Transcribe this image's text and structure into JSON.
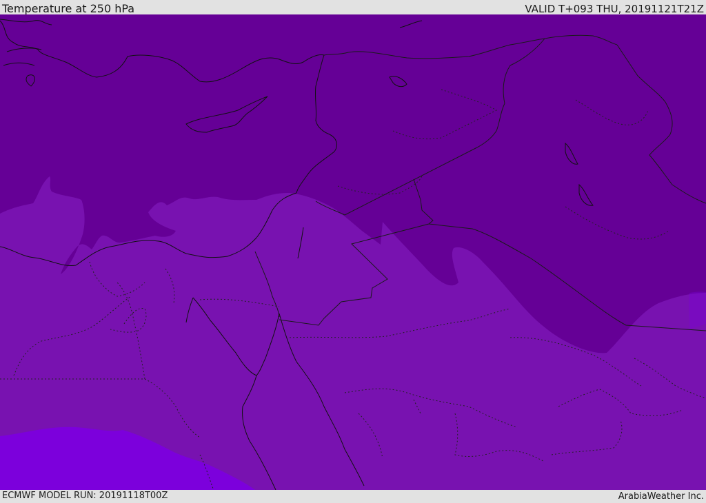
{
  "header": {
    "title": "Temperature at 250 hPa",
    "valid": "VALID T+093 THU, 20191121T21Z"
  },
  "footer": {
    "model_run": "ECMWF MODEL RUN: 20191118T00Z",
    "credit": "ArabiaWeather Inc."
  },
  "colors": {
    "band_dark": "#650096",
    "band_mid": "#7812b0",
    "band_light": "#7c00dc",
    "coast": "#111111",
    "border": "#1a1a1a"
  }
}
